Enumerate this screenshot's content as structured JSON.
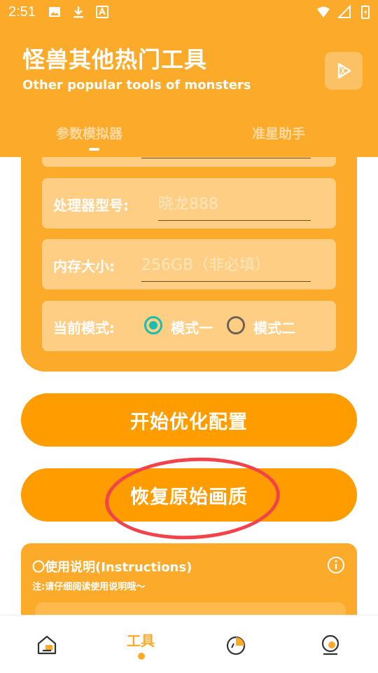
{
  "status_bar": {
    "time": "2:51"
  },
  "header": {
    "title_cn": "怪兽其他热门工具",
    "title_en": "Other popular tools of monsters",
    "store_icon": "play-store-icon",
    "tabs": [
      {
        "label": "参数模拟器",
        "active": true
      },
      {
        "label": "准星助手",
        "active": false
      }
    ]
  },
  "config": {
    "processor": {
      "label": "处理器型号:",
      "placeholder": "晓龙888"
    },
    "memory": {
      "label": "内存大小:",
      "placeholder": "256GB（非必填）"
    },
    "mode": {
      "label": "当前模式:",
      "options": [
        {
          "label": "模式一",
          "selected": true
        },
        {
          "label": "模式二",
          "selected": false
        }
      ]
    }
  },
  "buttons": {
    "start_optimize": "开始优化配置",
    "restore_quality": "恢复原始画质"
  },
  "instructions": {
    "title": "〇使用说明(Instructions)",
    "note": "注:请仔细阅读使用说明哦～"
  },
  "bottom_nav": {
    "items": [
      {
        "icon": "home-icon",
        "label": ""
      },
      {
        "icon": "tools",
        "label": "工具",
        "active": true
      },
      {
        "icon": "chart-icon",
        "label": ""
      },
      {
        "icon": "profile-icon",
        "label": ""
      }
    ]
  },
  "colors": {
    "primary": "#FBAA29",
    "button": "#FF9C00",
    "field_bg": "#FFCE85",
    "radio_accent": "#17BFAE",
    "annotation": "#F2434B"
  }
}
